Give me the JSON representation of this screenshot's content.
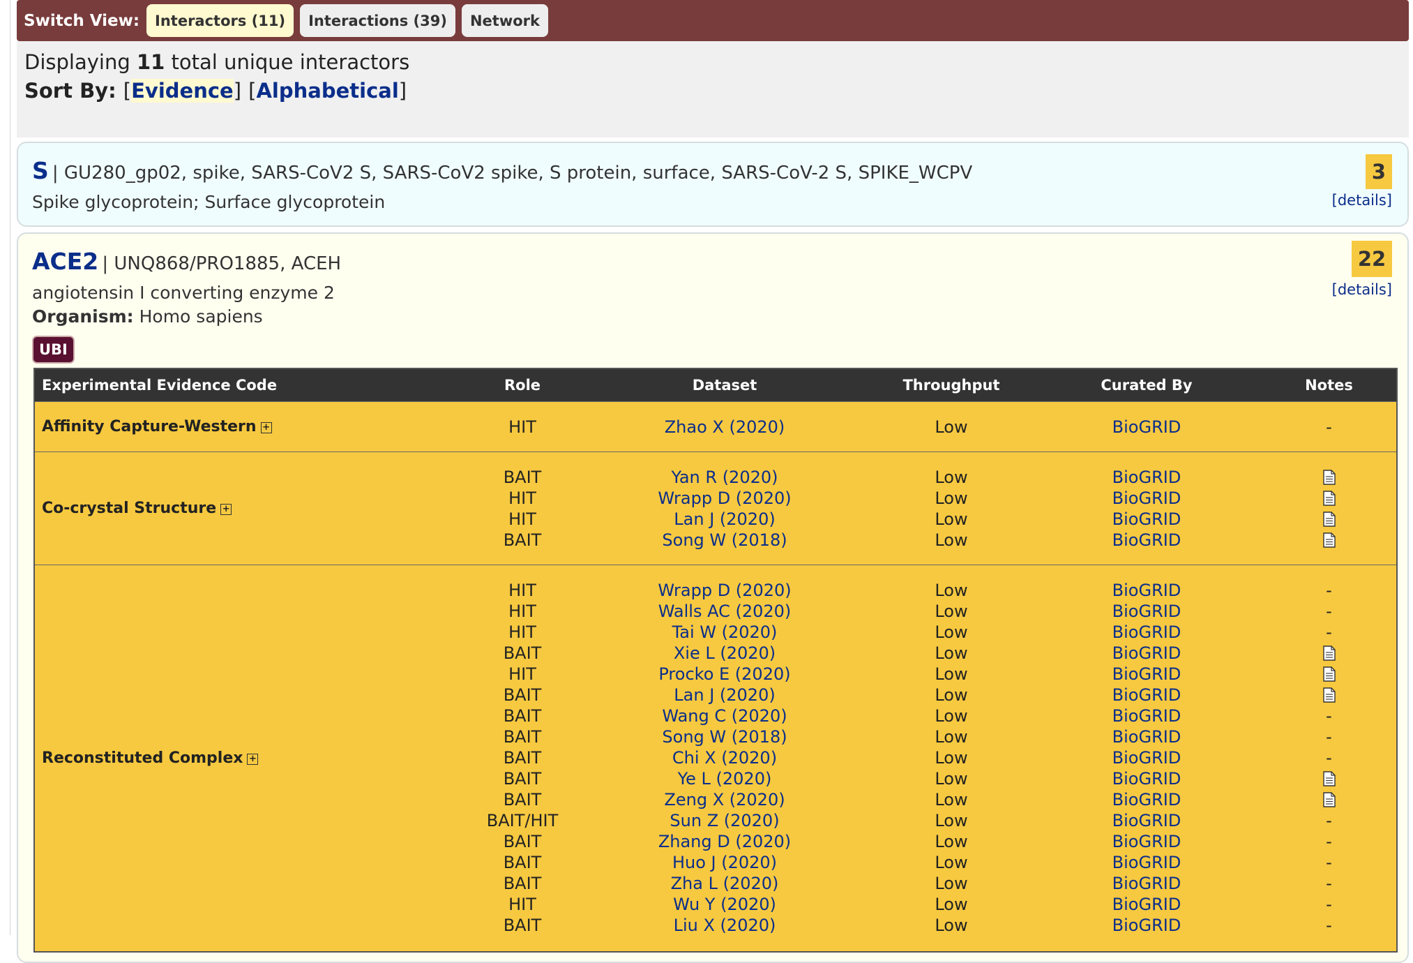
{
  "switch_view": {
    "label": "Switch View:",
    "buttons": [
      "Interactors (11)",
      "Interactions (39)",
      "Network"
    ]
  },
  "summary": {
    "prefix": "Displaying",
    "count": "11",
    "suffix": "total unique interactors",
    "sort_label": "Sort By:",
    "sort_options": [
      "Evidence",
      "Alphabetical"
    ]
  },
  "interactors": [
    {
      "symbol": "S",
      "synonyms": "GU280_gp02, spike, SARS-CoV2 S, SARS-CoV2 spike, S protein, surface, SARS-CoV-2 S, SPIKE_WCPV",
      "description": "Spike glycoprotein; Surface glycoprotein",
      "count": "3",
      "details": "[details]"
    },
    {
      "symbol": "ACE2",
      "synonyms": "UNQ868/PRO1885, ACEH",
      "description": "angiotensin I converting enzyme 2",
      "organism_label": "Organism:",
      "organism": "Homo sapiens",
      "badge": "UBI",
      "count": "22",
      "details": "[details]"
    }
  ],
  "table": {
    "headers": [
      "Experimental Evidence Code",
      "Role",
      "Dataset",
      "Throughput",
      "Curated By",
      "Notes"
    ],
    "groups": [
      {
        "code": "Affinity Capture-Western",
        "rows": [
          {
            "role": "HIT",
            "dataset": "Zhao X (2020)",
            "throughput": "Low",
            "curated": "BioGRID",
            "note": "-"
          }
        ]
      },
      {
        "code": "Co-crystal Structure",
        "rows": [
          {
            "role": "BAIT",
            "dataset": "Yan R (2020)",
            "throughput": "Low",
            "curated": "BioGRID",
            "note": "doc"
          },
          {
            "role": "HIT",
            "dataset": "Wrapp D (2020)",
            "throughput": "Low",
            "curated": "BioGRID",
            "note": "doc"
          },
          {
            "role": "HIT",
            "dataset": "Lan J (2020)",
            "throughput": "Low",
            "curated": "BioGRID",
            "note": "doc"
          },
          {
            "role": "BAIT",
            "dataset": "Song W (2018)",
            "throughput": "Low",
            "curated": "BioGRID",
            "note": "doc"
          }
        ]
      },
      {
        "code": "Reconstituted Complex",
        "rows": [
          {
            "role": "HIT",
            "dataset": "Wrapp D (2020)",
            "throughput": "Low",
            "curated": "BioGRID",
            "note": "-"
          },
          {
            "role": "HIT",
            "dataset": "Walls AC (2020)",
            "throughput": "Low",
            "curated": "BioGRID",
            "note": "-"
          },
          {
            "role": "HIT",
            "dataset": "Tai W (2020)",
            "throughput": "Low",
            "curated": "BioGRID",
            "note": "-"
          },
          {
            "role": "BAIT",
            "dataset": "Xie L (2020)",
            "throughput": "Low",
            "curated": "BioGRID",
            "note": "doc"
          },
          {
            "role": "HIT",
            "dataset": "Procko E (2020)",
            "throughput": "Low",
            "curated": "BioGRID",
            "note": "doc"
          },
          {
            "role": "BAIT",
            "dataset": "Lan J (2020)",
            "throughput": "Low",
            "curated": "BioGRID",
            "note": "doc"
          },
          {
            "role": "BAIT",
            "dataset": "Wang C (2020)",
            "throughput": "Low",
            "curated": "BioGRID",
            "note": "-"
          },
          {
            "role": "BAIT",
            "dataset": "Song W (2018)",
            "throughput": "Low",
            "curated": "BioGRID",
            "note": "-"
          },
          {
            "role": "BAIT",
            "dataset": "Chi X (2020)",
            "throughput": "Low",
            "curated": "BioGRID",
            "note": "-"
          },
          {
            "role": "BAIT",
            "dataset": "Ye L (2020)",
            "throughput": "Low",
            "curated": "BioGRID",
            "note": "doc"
          },
          {
            "role": "BAIT",
            "dataset": "Zeng X (2020)",
            "throughput": "Low",
            "curated": "BioGRID",
            "note": "doc"
          },
          {
            "role": "BAIT/HIT",
            "dataset": "Sun Z (2020)",
            "throughput": "Low",
            "curated": "BioGRID",
            "note": "-"
          },
          {
            "role": "BAIT",
            "dataset": "Zhang D (2020)",
            "throughput": "Low",
            "curated": "BioGRID",
            "note": "-"
          },
          {
            "role": "BAIT",
            "dataset": "Huo J (2020)",
            "throughput": "Low",
            "curated": "BioGRID",
            "note": "-"
          },
          {
            "role": "BAIT",
            "dataset": "Zha L (2020)",
            "throughput": "Low",
            "curated": "BioGRID",
            "note": "-"
          },
          {
            "role": "HIT",
            "dataset": "Wu Y (2020)",
            "throughput": "Low",
            "curated": "BioGRID",
            "note": "-"
          },
          {
            "role": "BAIT",
            "dataset": "Liu X (2020)",
            "throughput": "Low",
            "curated": "BioGRID",
            "note": "-"
          }
        ]
      }
    ]
  }
}
